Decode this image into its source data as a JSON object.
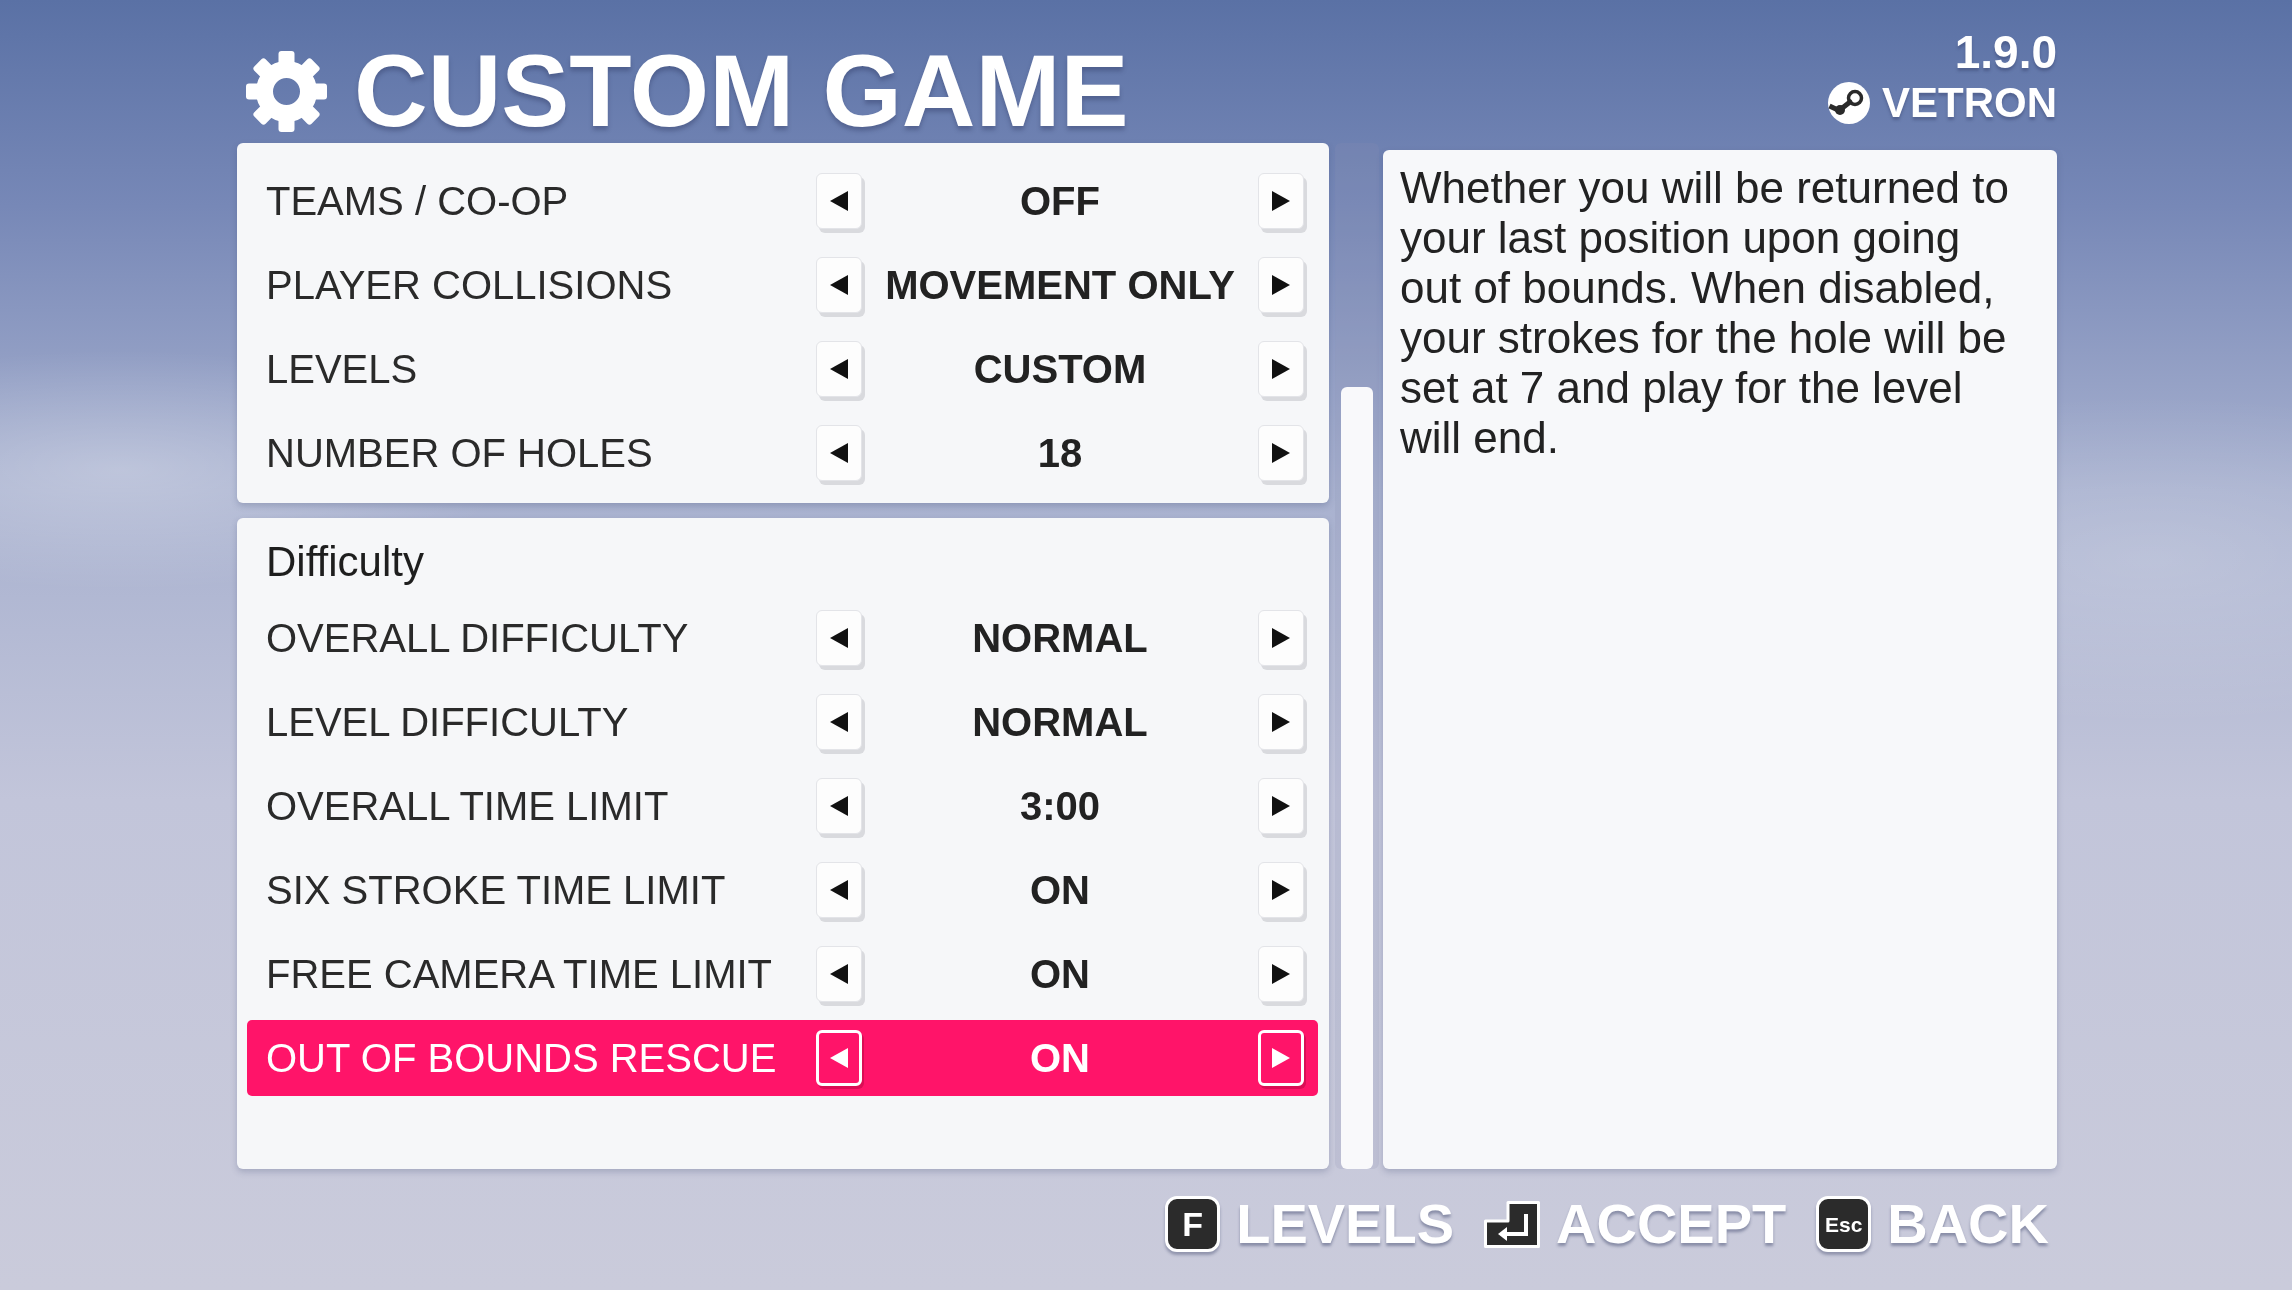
{
  "header": {
    "title": "CUSTOM GAME",
    "version": "1.9.0",
    "username": "VETRON"
  },
  "panels": [
    {
      "rows": [
        {
          "label": "TEAMS / CO-OP",
          "value": "OFF",
          "selected": false
        },
        {
          "label": "PLAYER COLLISIONS",
          "value": "MOVEMENT ONLY",
          "selected": false
        },
        {
          "label": "LEVELS",
          "value": "CUSTOM",
          "selected": false
        },
        {
          "label": "NUMBER OF HOLES",
          "value": "18",
          "selected": false
        }
      ]
    },
    {
      "heading": "Difficulty",
      "rows": [
        {
          "label": "OVERALL DIFFICULTY",
          "value": "NORMAL",
          "selected": false
        },
        {
          "label": "LEVEL DIFFICULTY",
          "value": "NORMAL",
          "selected": false
        },
        {
          "label": "OVERALL TIME LIMIT",
          "value": "3:00",
          "selected": false
        },
        {
          "label": "SIX STROKE TIME LIMIT",
          "value": "ON",
          "selected": false
        },
        {
          "label": "FREE CAMERA TIME LIMIT",
          "value": "ON",
          "selected": false
        },
        {
          "label": "OUT OF BOUNDS RESCUE",
          "value": "ON",
          "selected": true
        }
      ]
    }
  ],
  "description": "Whether you will be returned to your last position upon going out of bounds. When disabled, your strokes for the hole will be set at 7 and play for the level will end.",
  "hints": [
    {
      "kind": "letter",
      "key": "F",
      "label": "LEVELS"
    },
    {
      "kind": "enter",
      "label": "ACCEPT"
    },
    {
      "kind": "word",
      "key": "Esc",
      "label": "BACK"
    }
  ]
}
